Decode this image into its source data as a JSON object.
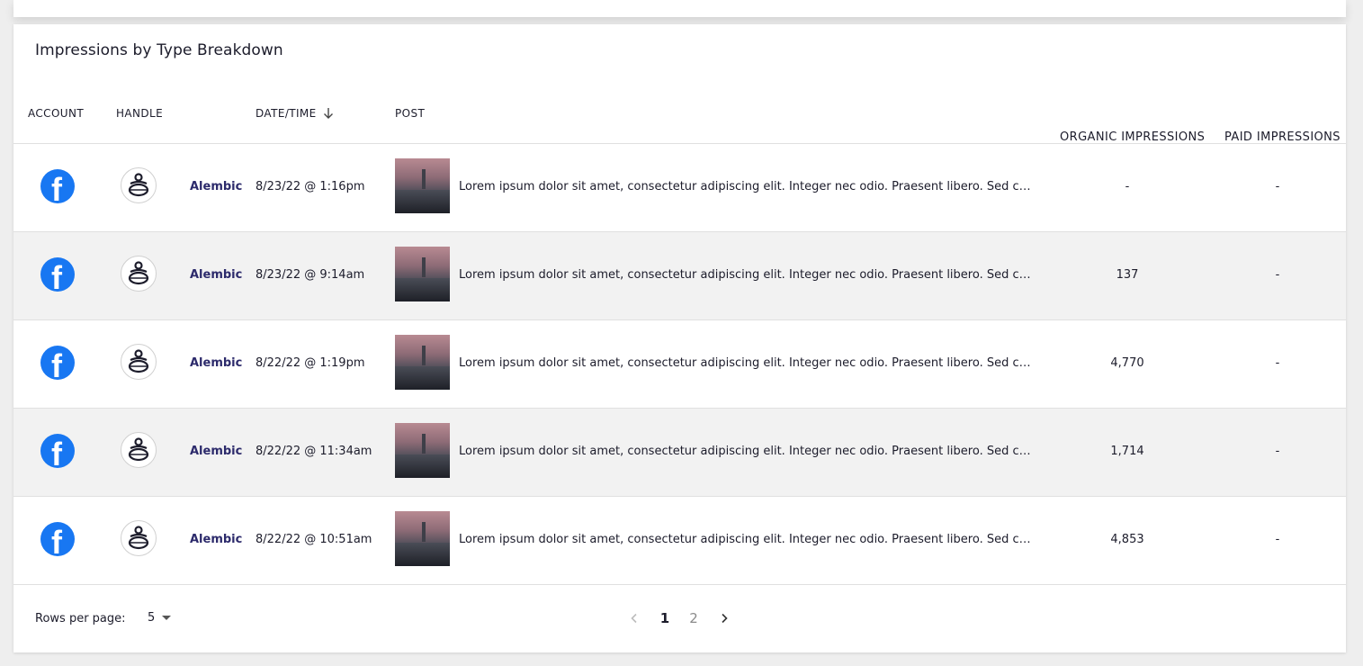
{
  "section_title": "Impressions by Type Breakdown",
  "columns": {
    "account": "ACCOUNT",
    "handle": "HANDLE",
    "datetime": "DATE/TIME",
    "post": "POST",
    "organic": "ORGANIC IMPRESSIONS",
    "paid": "PAID IMPRESSIONS"
  },
  "rows": [
    {
      "account_icon": "facebook-icon",
      "handle": "Alembic",
      "datetime": "8/23/22 @ 1:16pm",
      "post": "Lorem ipsum dolor sit amet, consectetur adipiscing elit. Integer nec odio. Praesent libero. Sed cur...",
      "organic": "-",
      "paid": "-"
    },
    {
      "account_icon": "facebook-icon",
      "handle": "Alembic",
      "datetime": "8/23/22 @ 9:14am",
      "post": "Lorem ipsum dolor sit amet, consectetur adipiscing elit. Integer nec odio. Praesent libero. Sed cur...",
      "organic": "137",
      "paid": "-"
    },
    {
      "account_icon": "facebook-icon",
      "handle": "Alembic",
      "datetime": "8/22/22 @ 1:19pm",
      "post": "Lorem ipsum dolor sit amet, consectetur adipiscing elit. Integer nec odio. Praesent libero. Sed cur...",
      "organic": "4,770",
      "paid": "-"
    },
    {
      "account_icon": "facebook-icon",
      "handle": "Alembic",
      "datetime": "8/22/22 @ 11:34am",
      "post": "Lorem ipsum dolor sit amet, consectetur adipiscing elit. Integer nec odio. Praesent libero. Sed cur...",
      "organic": "1,714",
      "paid": "-"
    },
    {
      "account_icon": "facebook-icon",
      "handle": "Alembic",
      "datetime": "8/22/22 @ 10:51am",
      "post": "Lorem ipsum dolor sit amet, consectetur adipiscing elit. Integer nec odio. Praesent libero. Sed cur...",
      "organic": "4,853",
      "paid": "-"
    }
  ],
  "footer": {
    "rows_per_page_label": "Rows per page:",
    "rows_per_page_value": "5",
    "pages": [
      "1",
      "2"
    ],
    "current_page": "1"
  },
  "colors": {
    "facebook_blue": "#1877f2",
    "handle_text": "#2c2a6b",
    "row_alt_bg": "#f2f2f2"
  }
}
